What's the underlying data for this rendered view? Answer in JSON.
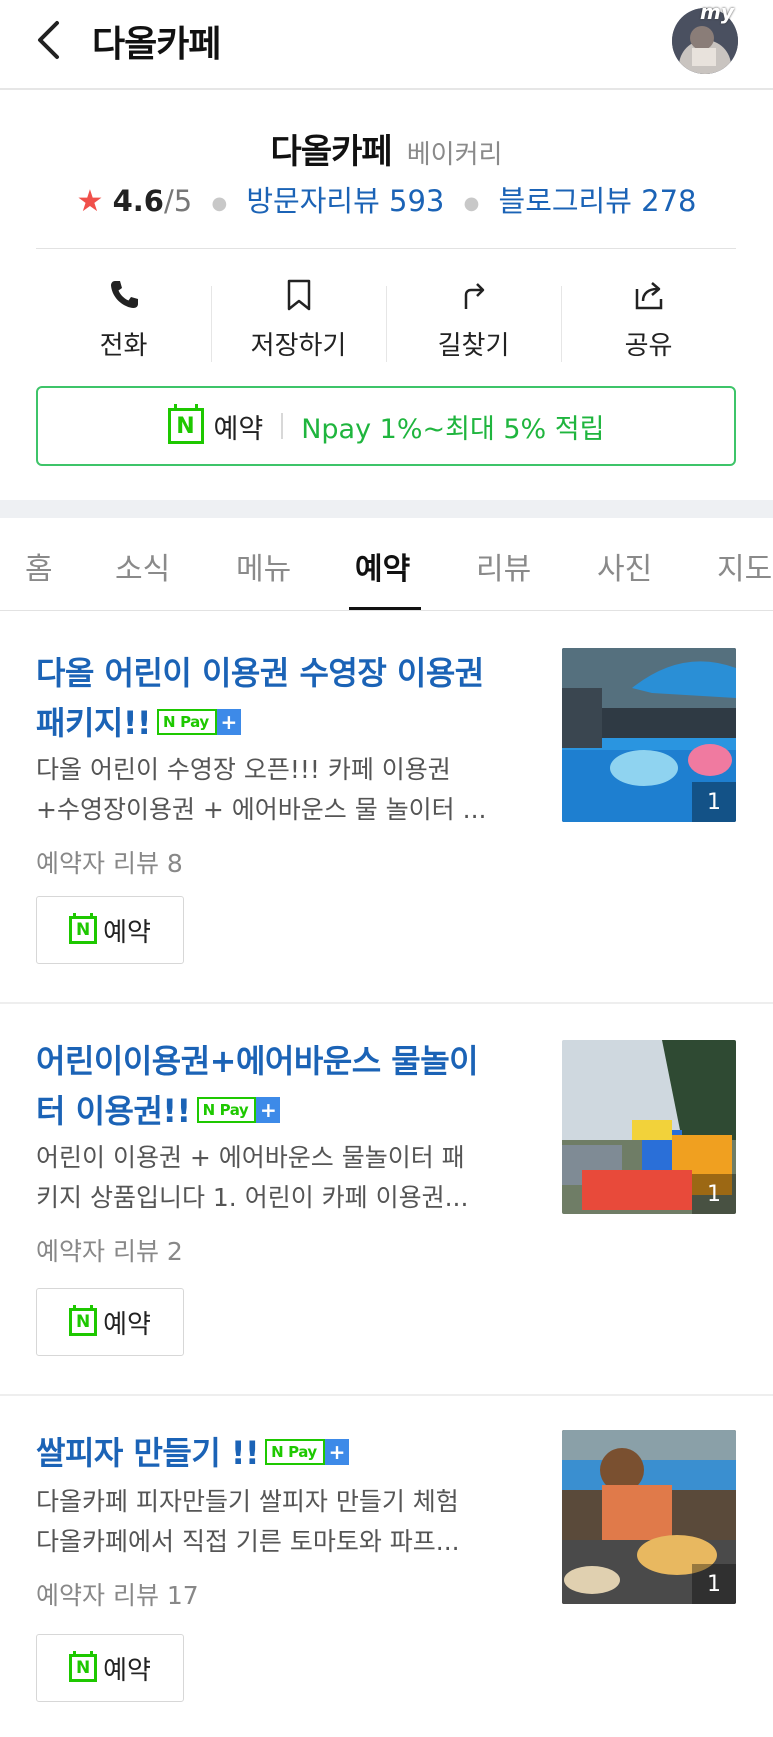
{
  "topbar": {
    "title": "다올카페",
    "avatar_badge": "my"
  },
  "place": {
    "name": "다올카페",
    "category": "베이커리",
    "rating": "4.6",
    "rating_max": "/5",
    "visitor_reviews": "방문자리뷰 593",
    "blog_reviews": "블로그리뷰 278"
  },
  "actions": [
    {
      "label": "전화",
      "icon": "phone-icon"
    },
    {
      "label": "저장하기",
      "icon": "bookmark-icon"
    },
    {
      "label": "길찾기",
      "icon": "directions-icon"
    },
    {
      "label": "공유",
      "icon": "share-icon"
    }
  ],
  "npay_banner": {
    "logo": "N",
    "reserve": "예약",
    "benefit": "Npay 1%~최대 5% 적립"
  },
  "tabs": [
    {
      "label": "홈"
    },
    {
      "label": "소식"
    },
    {
      "label": "메뉴"
    },
    {
      "label": "예약",
      "active": true
    },
    {
      "label": "리뷰"
    },
    {
      "label": "사진"
    },
    {
      "label": "지도"
    }
  ],
  "items": [
    {
      "title_line1": "다올 어린이 이용권 수영장 이용권",
      "title_line2": "패키지!!",
      "npay_tag": "Pay",
      "desc_line1": "다올 어린이 수영장 오픈!!! 카페 이용권",
      "desc_line2": "+수영장이용권 + 에어바운스 물 놀이터 ...",
      "review": "예약자 리뷰 8",
      "button": "예약",
      "photo_count": "1"
    },
    {
      "title_line1": "어린이이용권+에어바운스 물놀이",
      "title_line2": "터 이용권!!",
      "npay_tag": "Pay",
      "desc_line1": "어린이 이용권 + 에어바운스 물놀이터 패",
      "desc_line2": "키지 상품입니다 1. 어린이 카페 이용권...",
      "review": "예약자 리뷰 2",
      "button": "예약",
      "photo_count": "1"
    },
    {
      "title_line1": "쌀피자 만들기 !!",
      "npay_tag": "Pay",
      "desc_line1": "다올카페 피자만들기 쌀피자 만들기 체험",
      "desc_line2": "다올카페에서 직접 기른 토마토와 파프...",
      "review": "예약자 리뷰 17",
      "button": "예약",
      "photo_count": "1"
    }
  ],
  "colors": {
    "link_blue": "#1b63b6",
    "npay_green": "#1ec800",
    "star_red": "#f0504a"
  }
}
